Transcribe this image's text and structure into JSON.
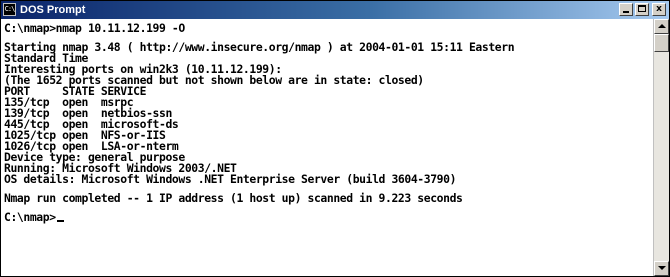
{
  "window": {
    "title": "DOS Prompt",
    "icon": "command-prompt-icon",
    "controls": [
      "minimize-icon",
      "maximize-icon",
      "close-icon"
    ],
    "close_glyph": "x",
    "colors": {
      "titlebar_start": "#0a246a",
      "titlebar_end": "#a6caf0",
      "console_bg": "#ffffff",
      "console_text": "#000000"
    }
  },
  "console": {
    "lines": [
      "C:\\nmap>nmap 10.11.12.199 -O",
      "",
      "Starting nmap 3.48 ( http://www.insecure.org/nmap ) at 2004-01-01 15:11 Eastern",
      "Standard Time",
      "Interesting ports on win2k3 (10.11.12.199):",
      "(The 1652 ports scanned but not shown below are in state: closed)",
      "PORT     STATE SERVICE",
      "135/tcp  open  msrpc",
      "139/tcp  open  netbios-ssn",
      "445/tcp  open  microsoft-ds",
      "1025/tcp open  NFS-or-IIS",
      "1026/tcp open  LSA-or-nterm",
      "Device type: general purpose",
      "Running: Microsoft Windows 2003/.NET",
      "OS details: Microsoft Windows .NET Enterprise Server (build 3604-3790)",
      "",
      "Nmap run completed -- 1 IP address (1 host up) scanned in 9.223 seconds",
      "",
      "C:\\nmap>"
    ]
  },
  "scrollbar": {
    "up_icon": "scroll-up-arrow-icon",
    "down_icon": "scroll-down-arrow-icon"
  }
}
